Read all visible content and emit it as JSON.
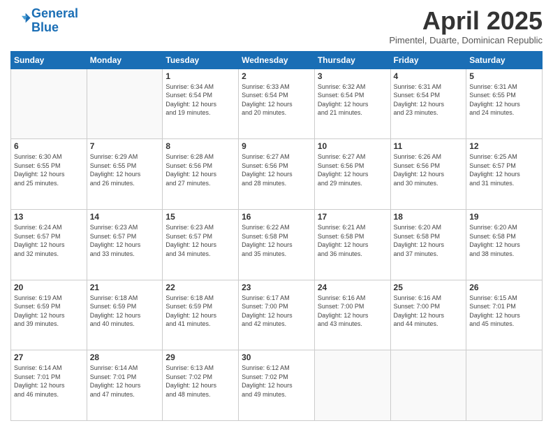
{
  "header": {
    "logo_line1": "General",
    "logo_line2": "Blue",
    "title": "April 2025",
    "location": "Pimentel, Duarte, Dominican Republic"
  },
  "days_of_week": [
    "Sunday",
    "Monday",
    "Tuesday",
    "Wednesday",
    "Thursday",
    "Friday",
    "Saturday"
  ],
  "weeks": [
    [
      {
        "num": "",
        "info": ""
      },
      {
        "num": "",
        "info": ""
      },
      {
        "num": "1",
        "info": "Sunrise: 6:34 AM\nSunset: 6:54 PM\nDaylight: 12 hours\nand 19 minutes."
      },
      {
        "num": "2",
        "info": "Sunrise: 6:33 AM\nSunset: 6:54 PM\nDaylight: 12 hours\nand 20 minutes."
      },
      {
        "num": "3",
        "info": "Sunrise: 6:32 AM\nSunset: 6:54 PM\nDaylight: 12 hours\nand 21 minutes."
      },
      {
        "num": "4",
        "info": "Sunrise: 6:31 AM\nSunset: 6:54 PM\nDaylight: 12 hours\nand 23 minutes."
      },
      {
        "num": "5",
        "info": "Sunrise: 6:31 AM\nSunset: 6:55 PM\nDaylight: 12 hours\nand 24 minutes."
      }
    ],
    [
      {
        "num": "6",
        "info": "Sunrise: 6:30 AM\nSunset: 6:55 PM\nDaylight: 12 hours\nand 25 minutes."
      },
      {
        "num": "7",
        "info": "Sunrise: 6:29 AM\nSunset: 6:55 PM\nDaylight: 12 hours\nand 26 minutes."
      },
      {
        "num": "8",
        "info": "Sunrise: 6:28 AM\nSunset: 6:56 PM\nDaylight: 12 hours\nand 27 minutes."
      },
      {
        "num": "9",
        "info": "Sunrise: 6:27 AM\nSunset: 6:56 PM\nDaylight: 12 hours\nand 28 minutes."
      },
      {
        "num": "10",
        "info": "Sunrise: 6:27 AM\nSunset: 6:56 PM\nDaylight: 12 hours\nand 29 minutes."
      },
      {
        "num": "11",
        "info": "Sunrise: 6:26 AM\nSunset: 6:56 PM\nDaylight: 12 hours\nand 30 minutes."
      },
      {
        "num": "12",
        "info": "Sunrise: 6:25 AM\nSunset: 6:57 PM\nDaylight: 12 hours\nand 31 minutes."
      }
    ],
    [
      {
        "num": "13",
        "info": "Sunrise: 6:24 AM\nSunset: 6:57 PM\nDaylight: 12 hours\nand 32 minutes."
      },
      {
        "num": "14",
        "info": "Sunrise: 6:23 AM\nSunset: 6:57 PM\nDaylight: 12 hours\nand 33 minutes."
      },
      {
        "num": "15",
        "info": "Sunrise: 6:23 AM\nSunset: 6:57 PM\nDaylight: 12 hours\nand 34 minutes."
      },
      {
        "num": "16",
        "info": "Sunrise: 6:22 AM\nSunset: 6:58 PM\nDaylight: 12 hours\nand 35 minutes."
      },
      {
        "num": "17",
        "info": "Sunrise: 6:21 AM\nSunset: 6:58 PM\nDaylight: 12 hours\nand 36 minutes."
      },
      {
        "num": "18",
        "info": "Sunrise: 6:20 AM\nSunset: 6:58 PM\nDaylight: 12 hours\nand 37 minutes."
      },
      {
        "num": "19",
        "info": "Sunrise: 6:20 AM\nSunset: 6:58 PM\nDaylight: 12 hours\nand 38 minutes."
      }
    ],
    [
      {
        "num": "20",
        "info": "Sunrise: 6:19 AM\nSunset: 6:59 PM\nDaylight: 12 hours\nand 39 minutes."
      },
      {
        "num": "21",
        "info": "Sunrise: 6:18 AM\nSunset: 6:59 PM\nDaylight: 12 hours\nand 40 minutes."
      },
      {
        "num": "22",
        "info": "Sunrise: 6:18 AM\nSunset: 6:59 PM\nDaylight: 12 hours\nand 41 minutes."
      },
      {
        "num": "23",
        "info": "Sunrise: 6:17 AM\nSunset: 7:00 PM\nDaylight: 12 hours\nand 42 minutes."
      },
      {
        "num": "24",
        "info": "Sunrise: 6:16 AM\nSunset: 7:00 PM\nDaylight: 12 hours\nand 43 minutes."
      },
      {
        "num": "25",
        "info": "Sunrise: 6:16 AM\nSunset: 7:00 PM\nDaylight: 12 hours\nand 44 minutes."
      },
      {
        "num": "26",
        "info": "Sunrise: 6:15 AM\nSunset: 7:01 PM\nDaylight: 12 hours\nand 45 minutes."
      }
    ],
    [
      {
        "num": "27",
        "info": "Sunrise: 6:14 AM\nSunset: 7:01 PM\nDaylight: 12 hours\nand 46 minutes."
      },
      {
        "num": "28",
        "info": "Sunrise: 6:14 AM\nSunset: 7:01 PM\nDaylight: 12 hours\nand 47 minutes."
      },
      {
        "num": "29",
        "info": "Sunrise: 6:13 AM\nSunset: 7:02 PM\nDaylight: 12 hours\nand 48 minutes."
      },
      {
        "num": "30",
        "info": "Sunrise: 6:12 AM\nSunset: 7:02 PM\nDaylight: 12 hours\nand 49 minutes."
      },
      {
        "num": "",
        "info": ""
      },
      {
        "num": "",
        "info": ""
      },
      {
        "num": "",
        "info": ""
      }
    ]
  ]
}
